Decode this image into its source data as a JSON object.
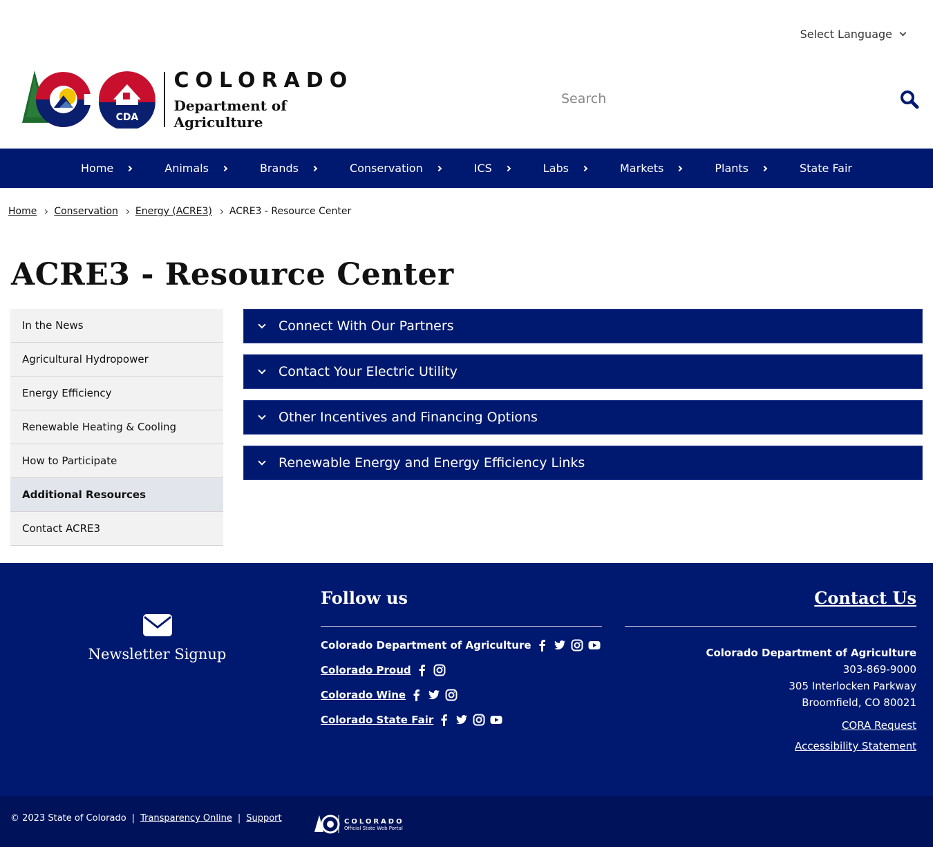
{
  "header": {
    "language_label": "Select Language",
    "logo_title": "COLORADO",
    "logo_subtitle": "Department of Agriculture",
    "logo_badge": "CDA",
    "search_placeholder": "Search"
  },
  "nav": {
    "items": [
      "Home",
      "Animals",
      "Brands",
      "Conservation",
      "ICS",
      "Labs",
      "Markets",
      "Plants",
      "State Fair"
    ]
  },
  "breadcrumb": {
    "items": [
      "Home",
      "Conservation",
      "Energy (ACRE3)"
    ],
    "current": "ACRE3 - Resource Center"
  },
  "page": {
    "title": "ACRE3 - Resource Center"
  },
  "sidenav": {
    "items": [
      "In the News",
      "Agricultural Hydropower",
      "Energy Efficiency",
      "Renewable Heating & Cooling",
      "How to Participate",
      "Additional Resources",
      "Contact ACRE3"
    ],
    "active_index": 5
  },
  "accordions": {
    "items": [
      "Connect With Our Partners",
      "Contact Your Electric Utility",
      "Other Incentives and Financing Options",
      "Renewable Energy and Energy Efficiency Links"
    ]
  },
  "footer": {
    "newsletter_label": "Newsletter Signup",
    "follow_title": "Follow us",
    "social": [
      {
        "label": "Colorado Department of Agriculture",
        "icons": [
          "facebook-icon",
          "twitter-icon",
          "instagram-icon",
          "youtube-icon"
        ]
      },
      {
        "label": "Colorado Proud",
        "icons": [
          "facebook-icon",
          "instagram-icon"
        ]
      },
      {
        "label": "Colorado Wine",
        "icons": [
          "facebook-icon",
          "twitter-icon",
          "instagram-icon"
        ]
      },
      {
        "label": "Colorado State Fair",
        "icons": [
          "facebook-icon",
          "twitter-icon",
          "instagram-icon",
          "youtube-icon"
        ]
      }
    ],
    "contact_title": "Contact Us",
    "contact_org": "Colorado Department of Agriculture",
    "contact_phone": "303-869-9000",
    "contact_address1": "305 Interlocken Parkway",
    "contact_address2": "Broomfield, CO 80021",
    "cora_link": "CORA Request",
    "accessibility_link": "Accessibility Statement"
  },
  "bottombar": {
    "copyright": "© 2023 State of Colorado",
    "sep": "|",
    "transparency": "Transparency Online",
    "support": "Support",
    "portal_title": "COLORADO",
    "portal_subtitle": "Official State Web Portal"
  },
  "colors": {
    "navy": "#001970",
    "bottom_navy": "#00135a",
    "side_bg": "#f2f2f2",
    "side_active": "#e2e5ec"
  }
}
